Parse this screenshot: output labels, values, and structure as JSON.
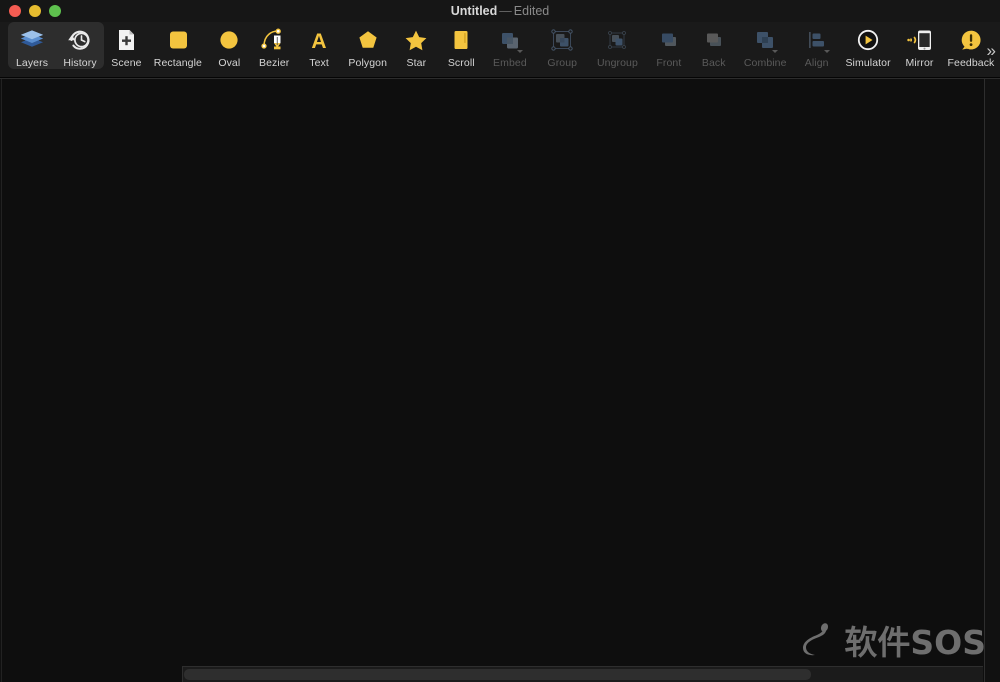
{
  "window": {
    "title_main": "Untitled",
    "title_separator": "—",
    "title_state": "Edited",
    "traffic_lights": [
      {
        "name": "close",
        "color": "#f45c52"
      },
      {
        "name": "minimize",
        "color": "#e6bc2f"
      },
      {
        "name": "zoom",
        "color": "#5ec14e"
      }
    ]
  },
  "toolbar": {
    "overflow_label": "»",
    "accent_color": "#f0c33c",
    "selected_group_color": "#2d2d2d",
    "items": [
      {
        "label": "Layers",
        "icon": "layers-icon",
        "enabled": true,
        "selected": true,
        "menu": false
      },
      {
        "label": "History",
        "icon": "history-icon",
        "enabled": true,
        "selected": true,
        "menu": false
      },
      {
        "label": "Scene",
        "icon": "scene-icon",
        "enabled": true,
        "selected": false,
        "menu": false
      },
      {
        "label": "Rectangle",
        "icon": "rectangle-icon",
        "enabled": true,
        "selected": false,
        "menu": false
      },
      {
        "label": "Oval",
        "icon": "oval-icon",
        "enabled": true,
        "selected": false,
        "menu": false
      },
      {
        "label": "Bezier",
        "icon": "bezier-pen-icon",
        "enabled": true,
        "selected": false,
        "menu": false
      },
      {
        "label": "Text",
        "icon": "text-icon",
        "enabled": true,
        "selected": false,
        "menu": false
      },
      {
        "label": "Polygon",
        "icon": "polygon-icon",
        "enabled": true,
        "selected": false,
        "menu": false
      },
      {
        "label": "Star",
        "icon": "star-icon",
        "enabled": true,
        "selected": false,
        "menu": false
      },
      {
        "label": "Scroll",
        "icon": "scroll-icon",
        "enabled": true,
        "selected": false,
        "menu": false
      },
      {
        "label": "Embed",
        "icon": "embed-icon",
        "enabled": false,
        "selected": false,
        "menu": true
      },
      {
        "label": "Group",
        "icon": "group-icon",
        "enabled": false,
        "selected": false,
        "menu": false
      },
      {
        "label": "Ungroup",
        "icon": "ungroup-icon",
        "enabled": false,
        "selected": false,
        "menu": false
      },
      {
        "label": "Front",
        "icon": "bring-front-icon",
        "enabled": false,
        "selected": false,
        "menu": false
      },
      {
        "label": "Back",
        "icon": "send-back-icon",
        "enabled": false,
        "selected": false,
        "menu": false
      },
      {
        "label": "Combine",
        "icon": "combine-icon",
        "enabled": false,
        "selected": false,
        "menu": true
      },
      {
        "label": "Align",
        "icon": "align-icon",
        "enabled": false,
        "selected": false,
        "menu": true
      },
      {
        "label": "Simulator",
        "icon": "simulator-play-icon",
        "enabled": true,
        "selected": false,
        "menu": false
      },
      {
        "label": "Mirror",
        "icon": "mirror-device-icon",
        "enabled": true,
        "selected": false,
        "menu": false
      },
      {
        "label": "Feedback",
        "icon": "feedback-icon",
        "enabled": true,
        "selected": false,
        "menu": false
      }
    ]
  },
  "canvas": {
    "background_color": "#0e0e0e"
  },
  "scrollbar": {
    "orientation": "horizontal",
    "thumb_color": "#2e2e2e",
    "track_color": "#1b1b1b"
  },
  "watermark": {
    "text": "软件SOS",
    "color": "#6e6e6e"
  }
}
